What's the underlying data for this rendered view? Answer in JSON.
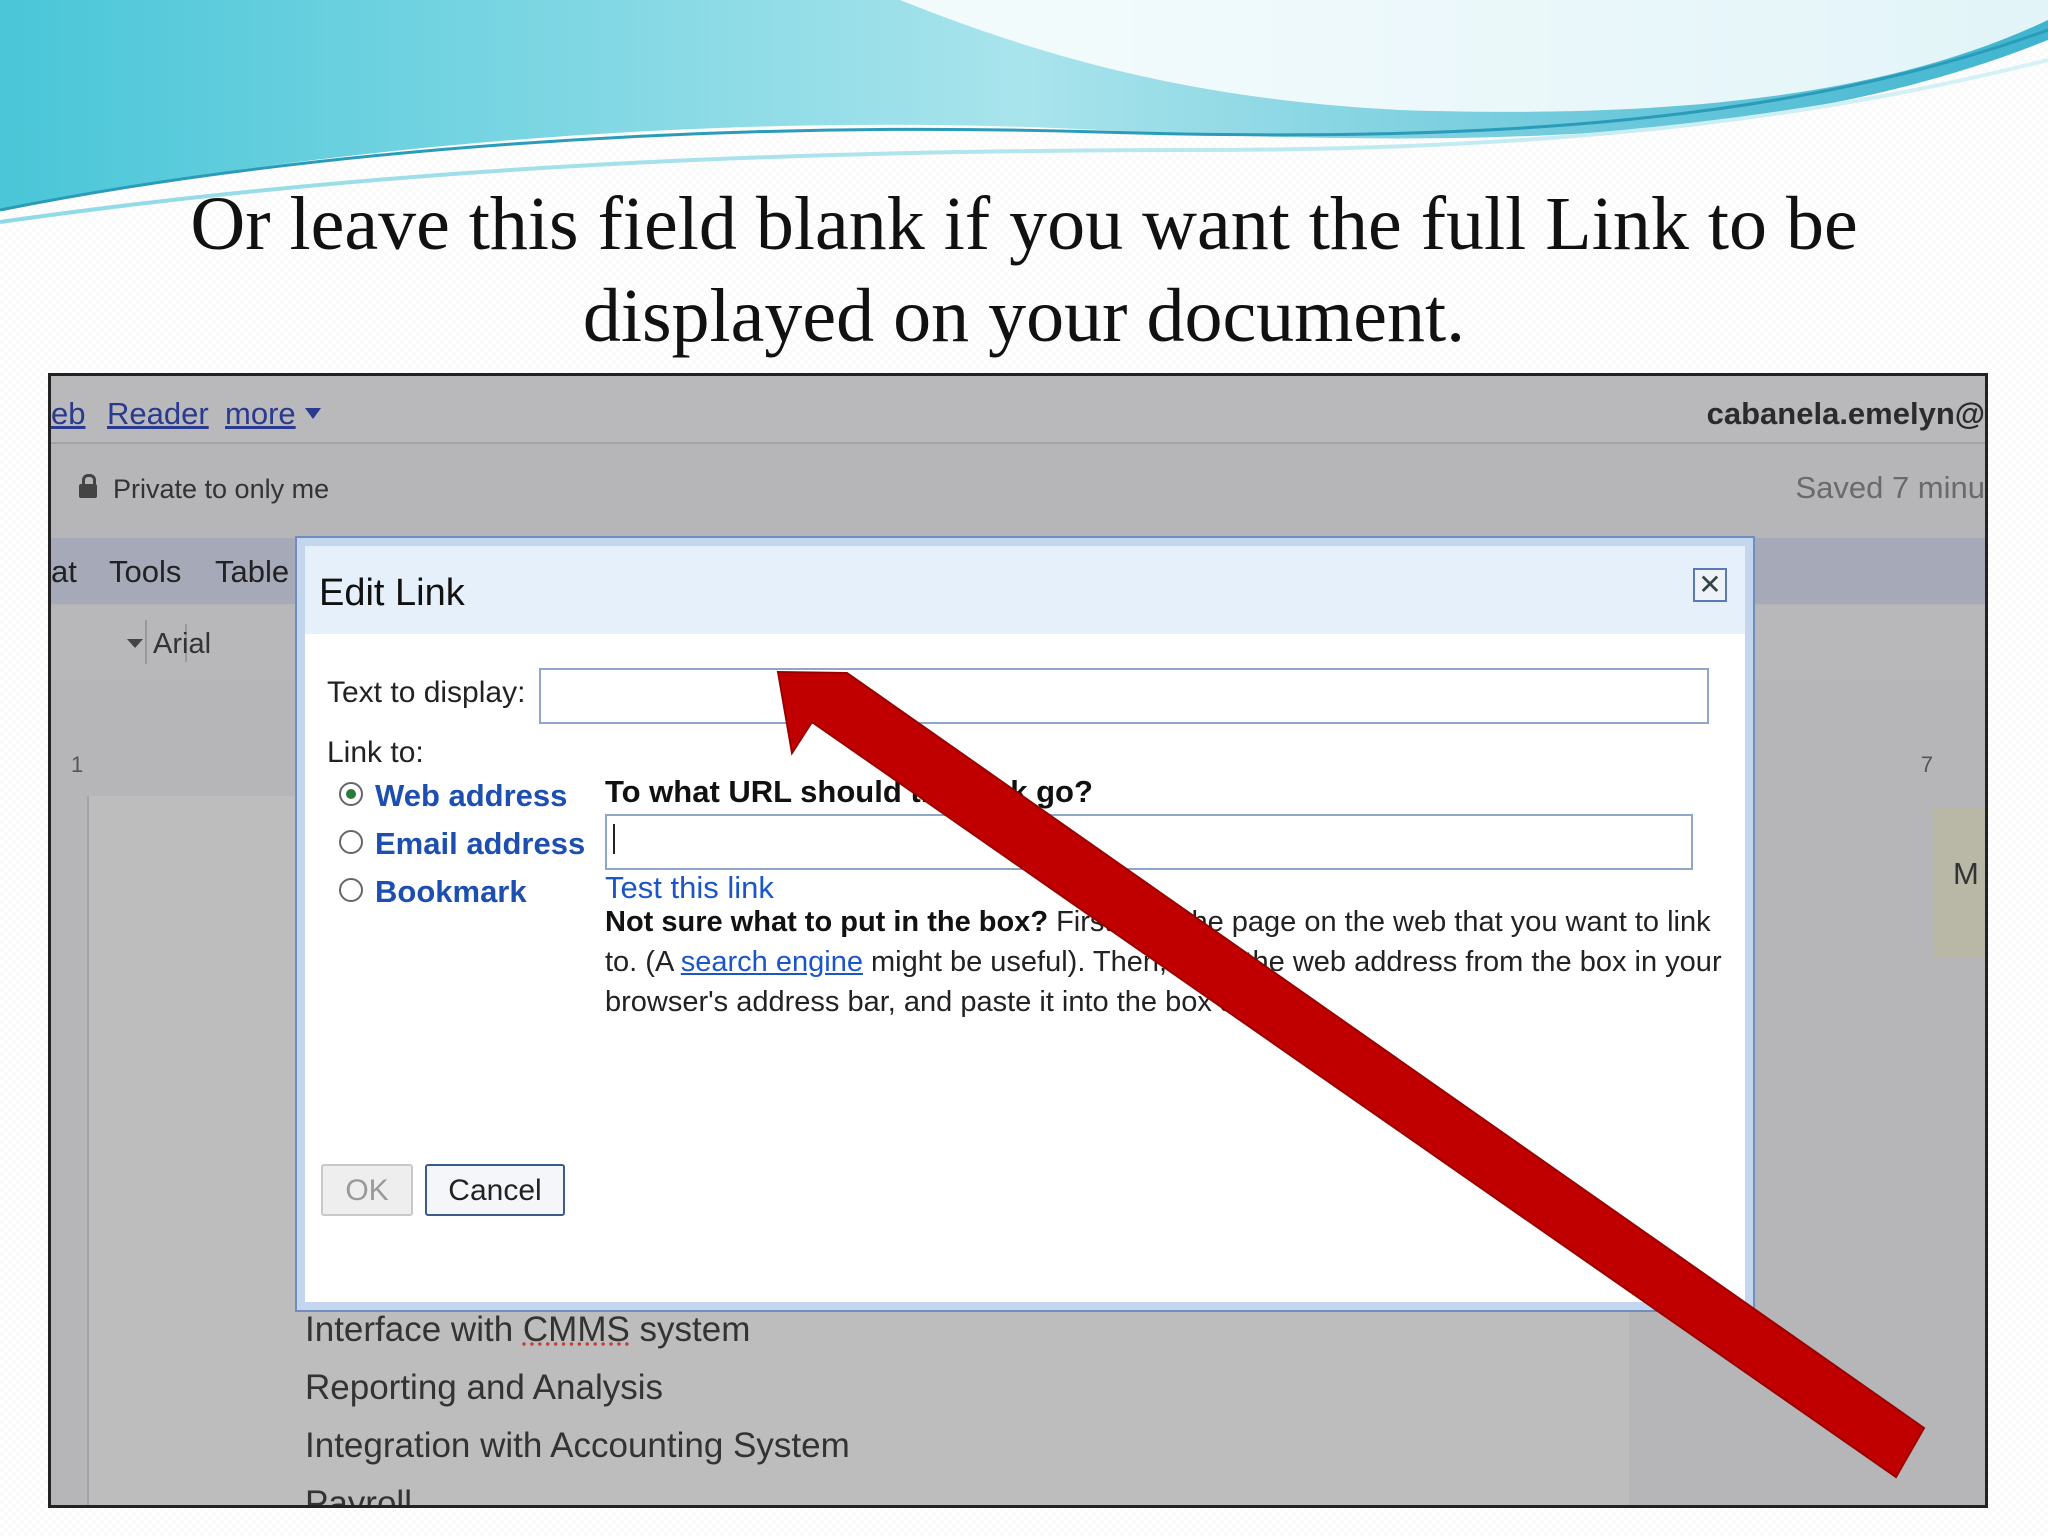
{
  "slide": {
    "title": "Or leave this field blank if you want the full Link to be displayed on your document."
  },
  "app": {
    "toplinks": [
      "eb",
      "Reader",
      "more"
    ],
    "user": "cabanela.emelyn@",
    "private_label": "Private to only me",
    "saved_label": "Saved 7 minu",
    "menu": [
      "at",
      "Tools",
      "Table"
    ],
    "font_name": "Arial",
    "ruler_left": "1",
    "ruler_right": "7",
    "side_letter": "M",
    "doc_lines": [
      "Interface with CMMS system",
      "Reporting and Analysis",
      "Integration with Accounting System",
      "Payroll"
    ]
  },
  "dialog": {
    "title": "Edit Link",
    "text_to_display_label": "Text to display:",
    "text_to_display_value": "",
    "link_to_label": "Link to:",
    "options": [
      "Web address",
      "Email address",
      "Bookmark"
    ],
    "selected_option": "Web address",
    "question": "To what URL should this link go?",
    "url_value": "",
    "test_link": "Test this link",
    "help_bold": "Not sure what to put in the box?",
    "help_1": " First, find the page on the web that you want to link to. (A ",
    "help_link": "search engine",
    "help_2": " might be useful). Then, copy the web address from the box in your browser's address bar, and paste it into the box above.",
    "ok_label": "OK",
    "cancel_label": "Cancel"
  },
  "colors": {
    "arrow": "#c00000",
    "link": "#1a56c8",
    "dialog_border": "#6f8dbd"
  },
  "icons": [
    "lock-icon",
    "close-icon",
    "dropdown-arrow-icon"
  ]
}
